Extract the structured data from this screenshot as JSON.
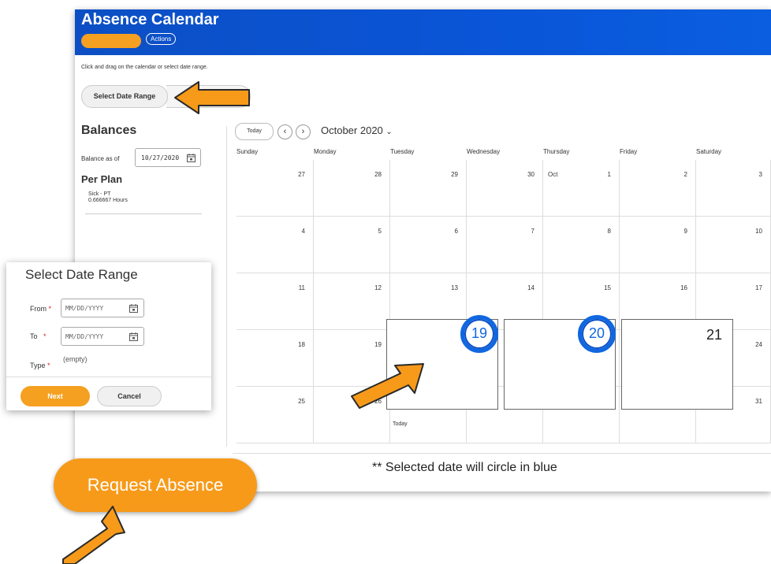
{
  "header": {
    "title": "Absence Calendar",
    "actions_label": "Actions"
  },
  "instructions": "Click and drag on the calendar or select date range.",
  "select_date_range_button": "Select Date Range",
  "balances": {
    "title": "Balances",
    "balance_as_of_label": "Balance as of",
    "balance_as_of_value": "10/27/2020",
    "per_plan_title": "Per Plan",
    "plan_name": "Sick - PT",
    "plan_hours": "0.666667 Hours"
  },
  "calendar": {
    "today_button": "Today",
    "prev_icon": "chevron-left-icon",
    "next_icon": "chevron-right-icon",
    "month_label": "October 2020",
    "weekdays": [
      "Sunday",
      "Monday",
      "Tuesday",
      "Wednesday",
      "Thursday",
      "Friday",
      "Saturday"
    ],
    "month_prefix": "Oct",
    "today_label": "Today",
    "weeks": [
      [
        "27",
        "28",
        "29",
        "30",
        "1",
        "2",
        "3"
      ],
      [
        "4",
        "5",
        "6",
        "7",
        "8",
        "9",
        "10"
      ],
      [
        "11",
        "12",
        "13",
        "14",
        "15",
        "16",
        "17"
      ],
      [
        "18",
        "19",
        "",
        "",
        "",
        "",
        "24"
      ],
      [
        "25",
        "26",
        "",
        "",
        "",
        "",
        "31"
      ]
    ],
    "selected_dates": [
      "19",
      "20",
      "21"
    ]
  },
  "selected_note": "** Selected date will circle in blue",
  "popup": {
    "title": "Select Date Range",
    "from_label": "From",
    "to_label": "To",
    "type_label": "Type",
    "required_mark": "*",
    "from_placeholder": "MM/DD/YYYY",
    "to_placeholder": "MM/DD/YYYY",
    "type_value": "(empty)",
    "next_button": "Next",
    "cancel_button": "Cancel"
  },
  "request_absence_button": "Request Absence",
  "colors": {
    "header_blue": "#0c4fc4",
    "accent_orange": "#f5a020",
    "selection_blue": "#1067e0"
  }
}
